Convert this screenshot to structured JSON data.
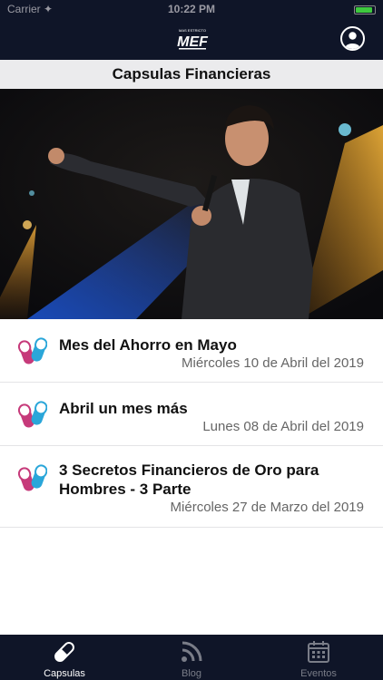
{
  "status_bar": {
    "carrier": "Carrier ✦",
    "time": "10:22 PM",
    "battery_level": 0.9
  },
  "app": {
    "logo_text": "MEF",
    "logo_tagline": "MAS ESTRICTO"
  },
  "section": {
    "title": "Capsulas Financieras"
  },
  "carousel": {
    "page_count": 2,
    "current_page": 1
  },
  "capsules": [
    {
      "title": "Mes del Ahorro en Mayo",
      "date": "Miércoles 10 de Abril del 2019"
    },
    {
      "title": "Abril un mes más",
      "date": "Lunes 08 de Abril del 2019"
    },
    {
      "title": "3 Secretos Financieros de Oro para Hombres - 3 Parte",
      "date": "Miércoles 27 de Marzo del 2019"
    }
  ],
  "tabs": [
    {
      "label": "Capsulas",
      "icon": "pill-icon",
      "active": true
    },
    {
      "label": "Blog",
      "icon": "rss-icon",
      "active": false
    },
    {
      "label": "Eventos",
      "icon": "calendar-icon",
      "active": false
    }
  ],
  "colors": {
    "nav_background": "#0f1528",
    "pill_pink": "#c63a7a",
    "pill_blue": "#2aa6d9",
    "tab_inactive": "#7a7d88"
  }
}
